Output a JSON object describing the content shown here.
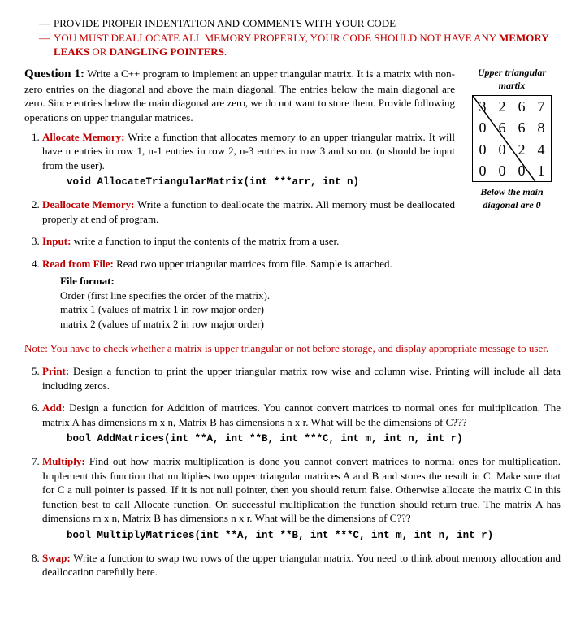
{
  "rules": {
    "r1": "PROVIDE PROPER INDENTATION AND COMMENTS WITH YOUR CODE",
    "r2a": "YOU MUST DEALLOCATE ALL MEMORY PROPERLY, YOUR CODE SHOULD NOT HAVE ANY ",
    "r2b": "MEMORY LEAKS",
    "r2c": " OR ",
    "r2d": "DANGLING POINTERS",
    "r2e": "."
  },
  "q1": {
    "title": "Question 1:",
    "body": " Write a C++ program to implement an upper triangular matrix. It is a matrix with non-zero entries on the diagonal and above the main diagonal. The entries below the main diagonal are zero. Since entries below the main diagonal are zero, we do not want to store them. Provide following operations on upper triangular matrices."
  },
  "fig": {
    "capTop": "Upper triangular martix",
    "capBot": "Below the main diagonal are 0",
    "m": [
      [
        "3",
        "2",
        "6",
        "7"
      ],
      [
        "0",
        "6",
        "6",
        "8"
      ],
      [
        "0",
        "0",
        "2",
        "4"
      ],
      [
        "0",
        "0",
        "0",
        "1"
      ]
    ]
  },
  "tasks": {
    "t1": {
      "title": "Allocate Memory:",
      "body": " Write a function that allocates memory to an upper triangular matrix. It will have n entries in row 1, n-1 entries in row 2, n-3 entries in row 3 and so on. (n should be input from the user).",
      "code": "void AllocateTriangularMatrix(int ***arr, int n)"
    },
    "t2": {
      "title": "Deallocate Memory:",
      "body": " Write a function to deallocate the matrix. All memory must be deallocated properly at end of program."
    },
    "t3": {
      "title": "Input:",
      "body": " write a function to input the contents of the matrix from a user."
    },
    "t4": {
      "title": "Read from File:",
      "body": " Read two upper triangular matrices from file. Sample is attached.",
      "ff_label": "File format:",
      "ff1": "Order   (first line specifies the order of the matrix).",
      "ff2": "matrix 1  (values of matrix 1 in row major order)",
      "ff3": "matrix 2  (values of matrix 2 in row major order)"
    },
    "note": "Note: You have to check whether a matrix is upper triangular or not before storage, and display appropriate message to user.",
    "t5": {
      "title": "Print:",
      "body": " Design a function to print the upper triangular matrix row wise and column wise. Printing will include all data including zeros."
    },
    "t6": {
      "title": "Add:",
      "body": " Design a function for Addition of matrices. You cannot convert matrices to normal ones for multiplication. The matrix A has dimensions m x n, Matrix B has dimensions n x r. What will be the dimensions of C???",
      "code": "bool AddMatrices(int **A, int **B, int ***C, int m, int n, int r)"
    },
    "t7": {
      "title": "Multiply:",
      "body": " Find out how matrix multiplication is done you cannot convert matrices to normal ones for multiplication. Implement this function that multiplies two upper triangular matrices A and B and stores the result in C. Make sure that for C a null pointer is passed. If it is not null pointer, then you should return false. Otherwise allocate the matrix C in this function best to call Allocate function. On successful multiplication the function should return true. The matrix A has dimensions m x n, Matrix B has dimensions n x r. What will be the dimensions of C???",
      "code": "bool MultiplyMatrices(int **A, int **B, int ***C, int m, int n, int r)"
    },
    "t8": {
      "title": "Swap:",
      "body": " Write a function to swap two rows of the upper triangular matrix. You need to think about memory allocation and deallocation carefully here."
    }
  }
}
